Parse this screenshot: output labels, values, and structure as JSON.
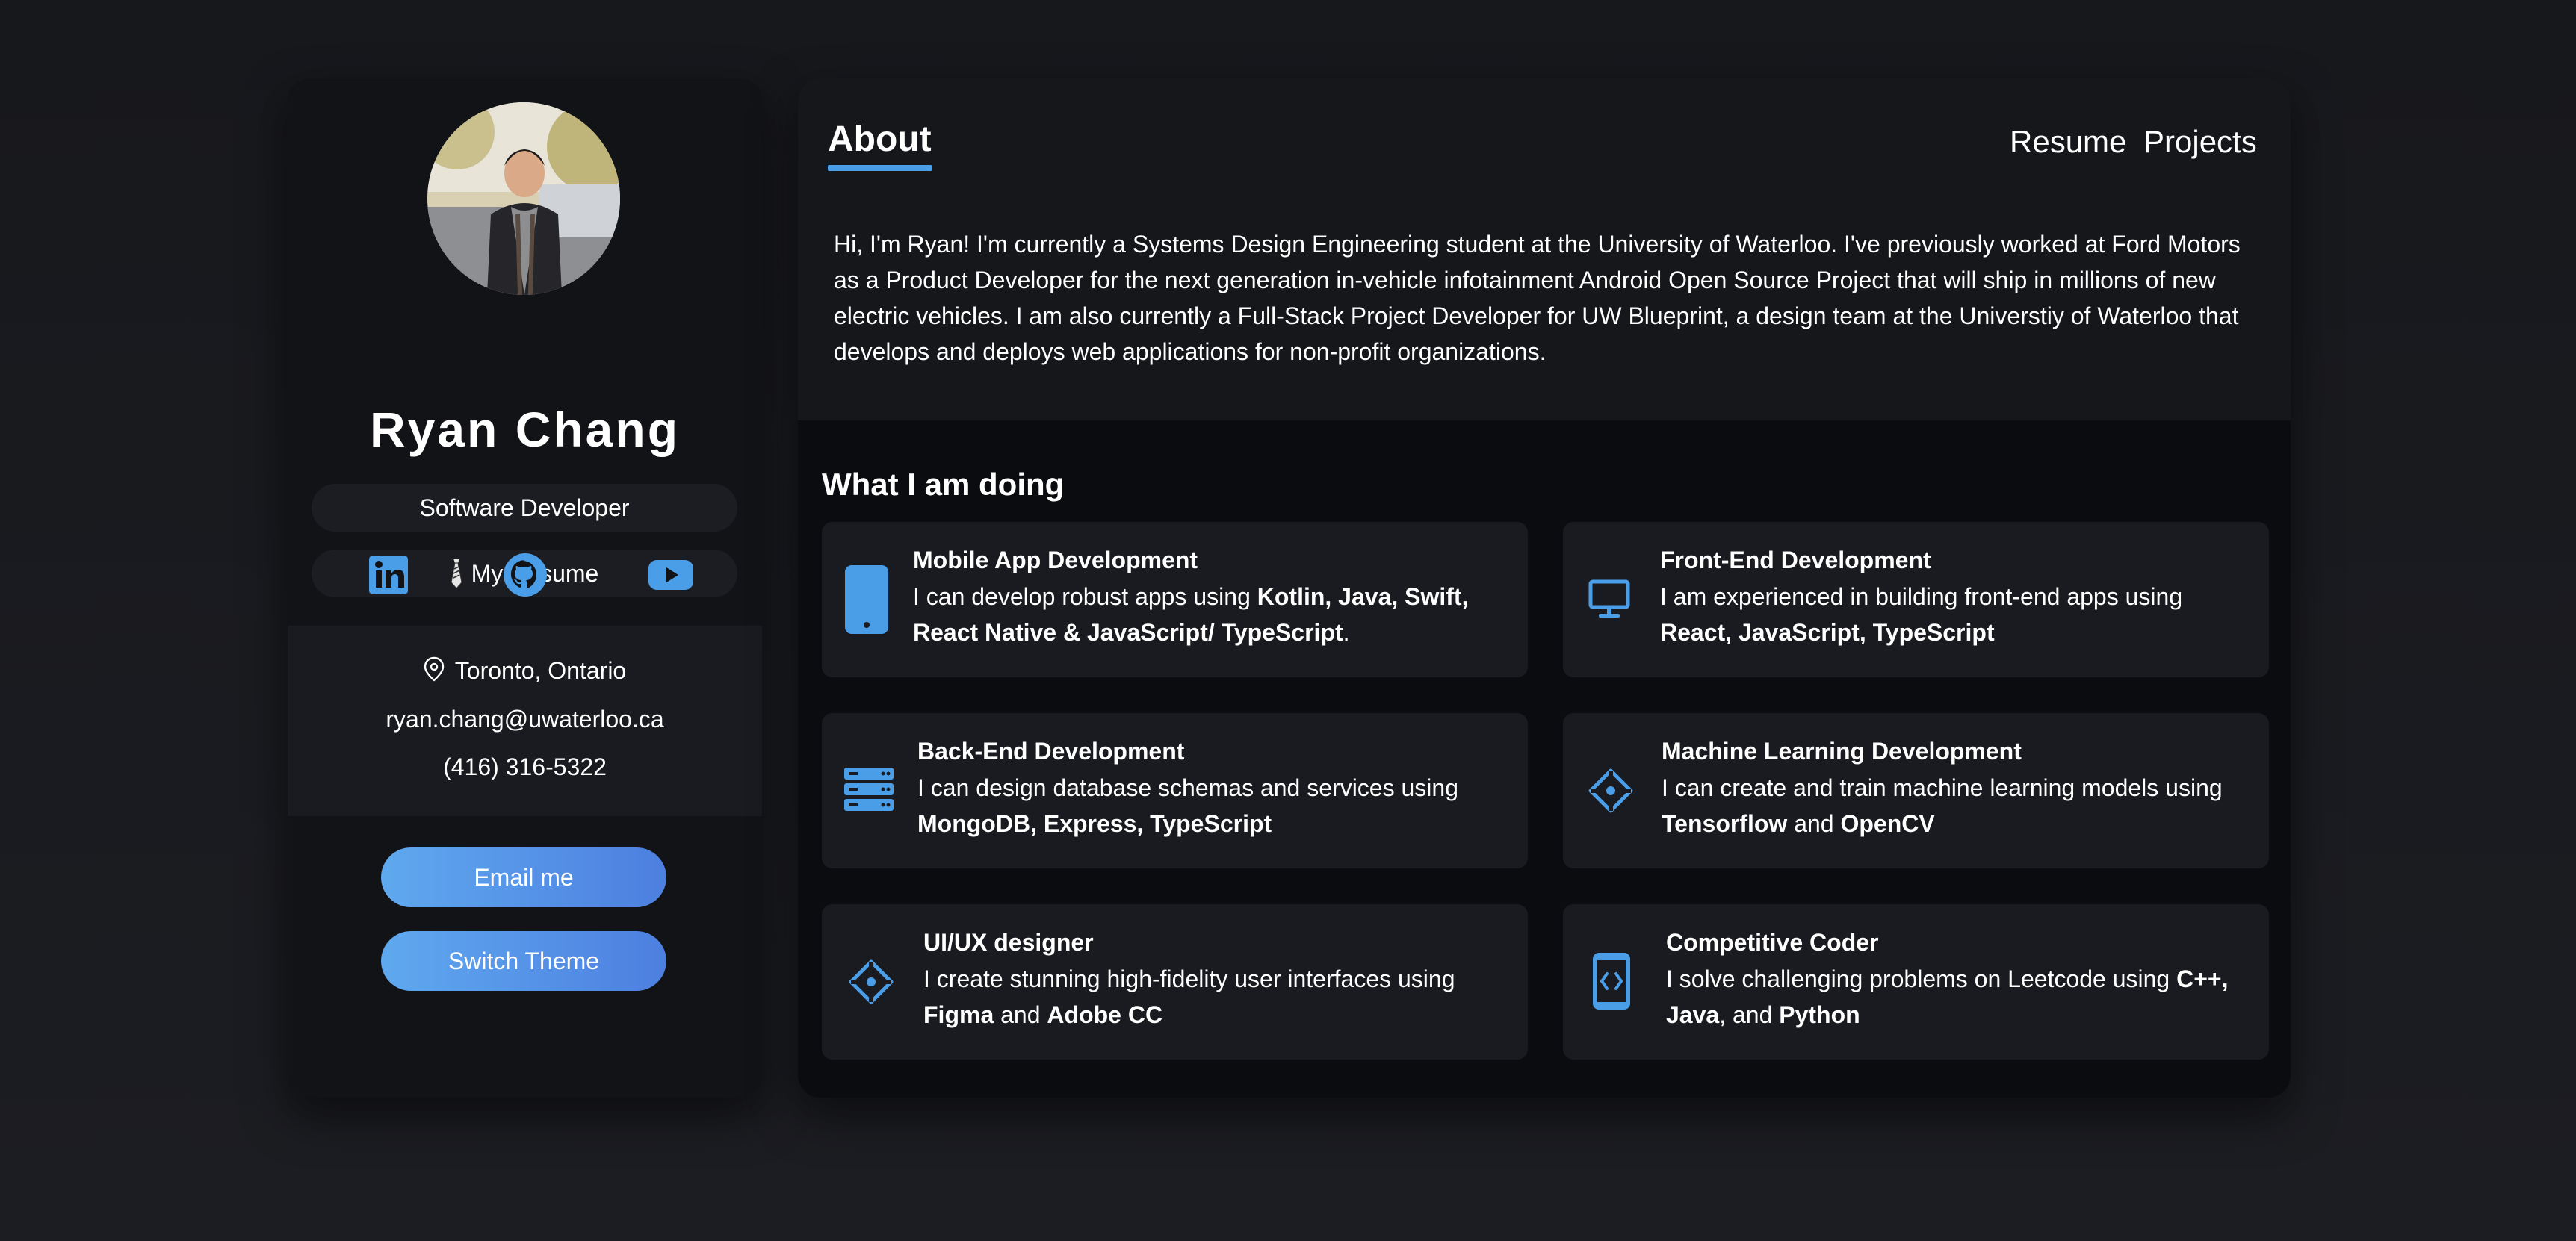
{
  "profile": {
    "name": "Ryan Chang",
    "title": "Software Developer",
    "resume_label": "My Resume",
    "socials": [
      "linkedin-icon",
      "github-icon",
      "youtube-icon"
    ],
    "location": "Toronto, Ontario",
    "email": "ryan.chang@uwaterloo.ca",
    "phone": "(416) 316-5322",
    "email_button": "Email me",
    "theme_button": "Switch Theme"
  },
  "nav": {
    "active": "About",
    "links": [
      "Resume",
      "Projects"
    ]
  },
  "about": {
    "text": "Hi, I'm Ryan! I'm currently a Systems Design Engineering student at the University of Waterloo. I've previously worked at Ford Motors as a Product Developer for the next generation in-vehicle infotainment Android Open Source Project that will ship in millions of new electric vehicles. I am also currently a Full-Stack Project Developer for UW Blueprint, a design team at the Universtiy of Waterloo that develops and deploys web applications for non-profit organizations."
  },
  "doing": {
    "title": "What I am doing",
    "services": [
      {
        "icon": "phone-icon",
        "title": "Mobile App Development",
        "body": [
          [
            "I can develop robust apps using ",
            false
          ],
          [
            "Kotlin, Java, Swift, React Native & JavaScript/ TypeScript",
            true
          ],
          [
            ".",
            false
          ]
        ]
      },
      {
        "icon": "monitor-icon",
        "title": "Front-End Development",
        "body": [
          [
            "I am experienced in building front-end apps using ",
            false
          ],
          [
            "React, JavaScript, TypeScript",
            true
          ]
        ]
      },
      {
        "icon": "server-icon",
        "title": "Back-End Development",
        "body": [
          [
            "I can design database schemas and services using ",
            false
          ],
          [
            "MongoDB, Express, TypeScript",
            true
          ]
        ]
      },
      {
        "icon": "diamond-icon",
        "title": "Machine Learning Development",
        "body": [
          [
            "I can create and train machine learning models using ",
            false
          ],
          [
            "Tensorflow",
            true
          ],
          [
            " and ",
            false
          ],
          [
            "OpenCV",
            true
          ]
        ]
      },
      {
        "icon": "diamond-icon",
        "title": "UI/UX designer",
        "body": [
          [
            "I create stunning high-fidelity user interfaces using ",
            false
          ],
          [
            "Figma",
            true
          ],
          [
            " and ",
            false
          ],
          [
            "Adobe CC",
            true
          ]
        ]
      },
      {
        "icon": "code-phone-icon",
        "title": "Competitive Coder",
        "body": [
          [
            "I solve challenging problems on Leetcode using ",
            false
          ],
          [
            "C++, Java",
            true
          ],
          [
            ", and ",
            false
          ],
          [
            "Python",
            true
          ]
        ]
      }
    ]
  },
  "colors": {
    "accent": "#4a9ee8",
    "button_start": "#5fa9ef",
    "button_end": "#4d7fe0"
  }
}
